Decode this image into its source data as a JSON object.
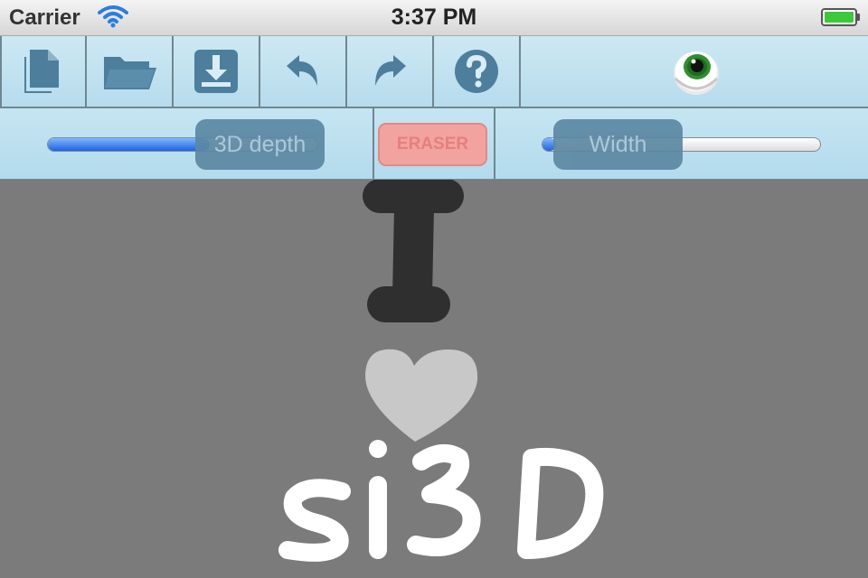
{
  "status": {
    "carrier": "Carrier",
    "time": "3:37 PM"
  },
  "toolbar": {
    "buttons": [
      {
        "name": "new-document",
        "icon": "documents-icon"
      },
      {
        "name": "open",
        "icon": "folder-icon"
      },
      {
        "name": "save",
        "icon": "download-icon"
      },
      {
        "name": "undo",
        "icon": "undo-icon"
      },
      {
        "name": "redo",
        "icon": "redo-icon"
      },
      {
        "name": "help",
        "icon": "question-icon"
      },
      {
        "name": "view-3d",
        "icon": "eye-icon"
      }
    ]
  },
  "controls": {
    "depth_label": "3D depth",
    "depth_value": 0.6,
    "eraser_label": "ERASER",
    "width_label": "Width",
    "width_value": 0.05
  },
  "colors": {
    "toolbar_bg": "#c6e5f2",
    "icon": "#4d7f9c",
    "canvas_bg": "#7b7b7b",
    "stroke_dark": "#2f2f2f",
    "stroke_light": "#c8c8c8",
    "stroke_white": "#ffffff",
    "eraser": "#f2a3a0"
  }
}
